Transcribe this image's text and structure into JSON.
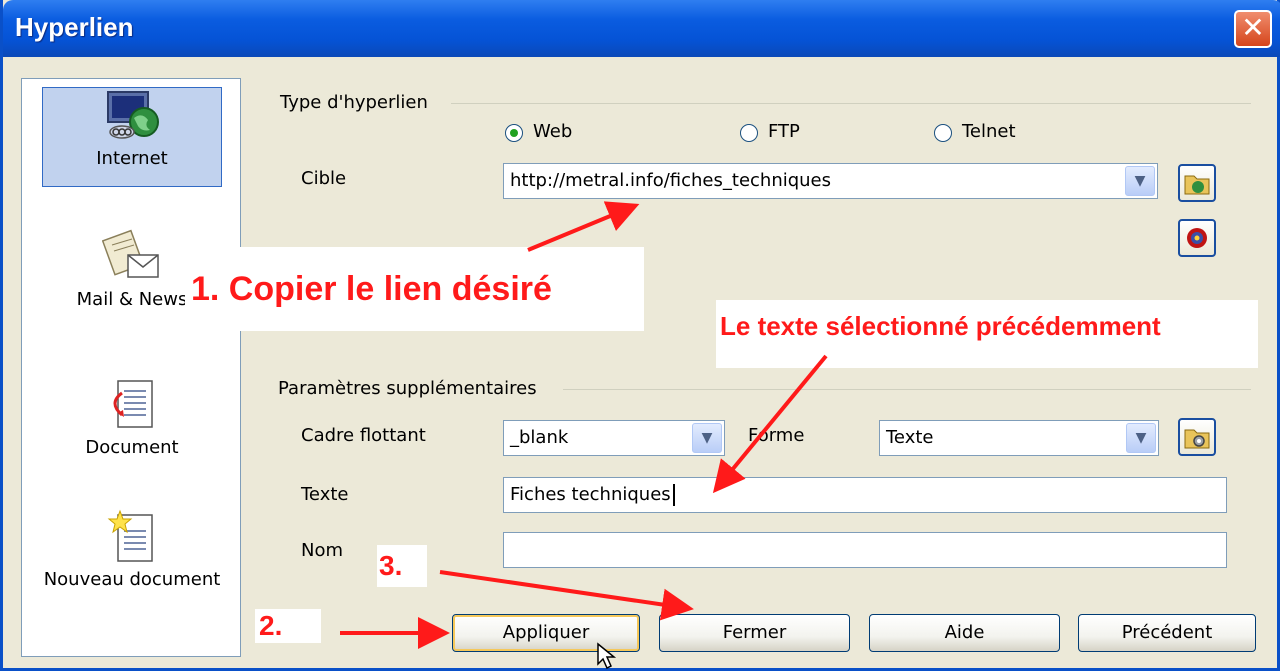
{
  "window": {
    "title": "Hyperlien",
    "close_glyph": "✕"
  },
  "sidebar": {
    "items": [
      {
        "label": "Internet",
        "icon": "globe-computer-icon",
        "active": true
      },
      {
        "label": "Mail & News",
        "icon": "mail-news-icon"
      },
      {
        "label": "Document",
        "icon": "document-icon"
      },
      {
        "label": "Nouveau document",
        "icon": "new-document-icon"
      }
    ]
  },
  "hyperlink_type": {
    "heading": "Type d'hyperlien",
    "options": [
      {
        "label": "Web",
        "selected": true
      },
      {
        "label": "FTP",
        "selected": false
      },
      {
        "label": "Telnet",
        "selected": false
      }
    ]
  },
  "target": {
    "label": "Cible",
    "value": "http://metral.info/fiches_techniques"
  },
  "extra": {
    "heading": "Paramètres supplémentaires",
    "frame_label": "Cadre flottant",
    "frame_value": "_blank",
    "form_label": "Forme",
    "form_value": "Texte",
    "text_label": "Texte",
    "text_value": "Fiches techniques",
    "name_label": "Nom",
    "name_value": ""
  },
  "buttons": {
    "apply": "Appliquer",
    "close": "Fermer",
    "help": "Aide",
    "previous": "Précédent"
  },
  "annotations": {
    "step1": "1.  Copier le lien désiré",
    "step2": "2.",
    "step3": "3.",
    "selected_text_note": "Le texte sélectionné précédemment"
  },
  "colors": {
    "annotation": "#ff1a1a",
    "titlebar": "#0a5ce0",
    "dialog_bg": "#ece9d8"
  }
}
